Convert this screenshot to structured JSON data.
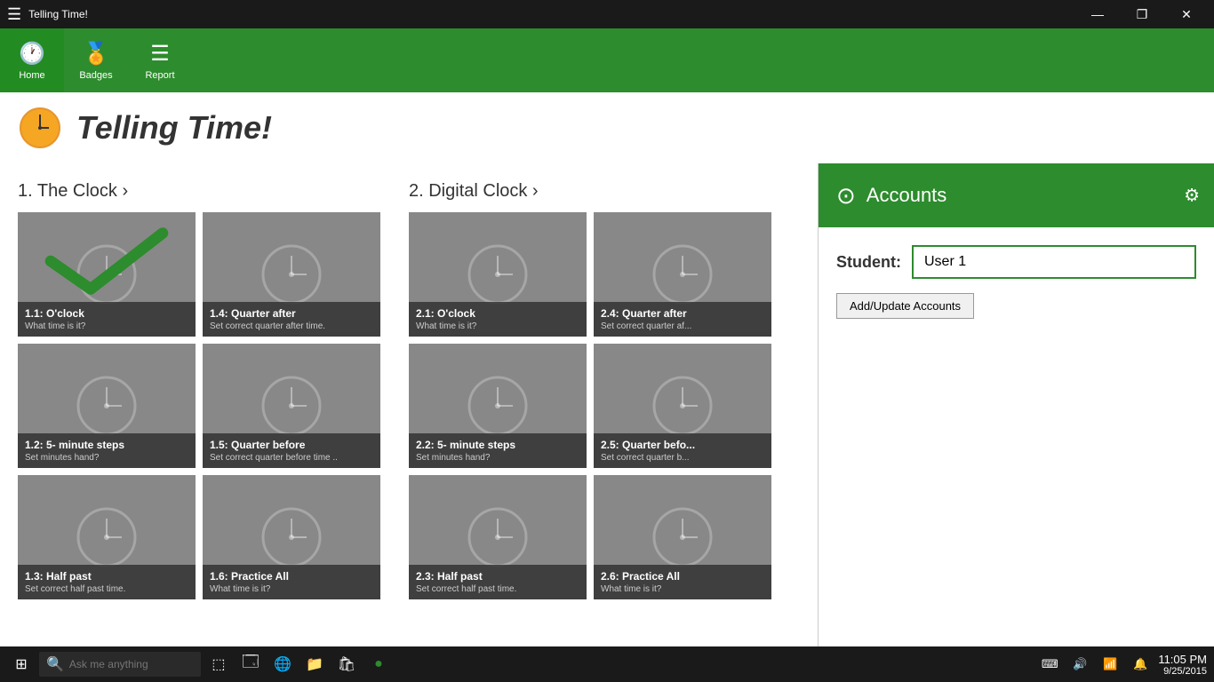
{
  "titleBar": {
    "appName": "Telling Time!",
    "minBtn": "—",
    "maxBtn": "❐",
    "closeBtn": "✕"
  },
  "toolbar": {
    "homeLabel": "Home",
    "badgesLabel": "Badges",
    "reportLabel": "Report"
  },
  "header": {
    "title": "Telling Time!"
  },
  "sections": [
    {
      "id": "clock",
      "title": "1. The Clock",
      "cards": [
        {
          "id": "1.1",
          "title": "1.1: O'clock",
          "subtitle": "What time is it?",
          "hasCheck": true
        },
        {
          "id": "1.4",
          "title": "1.4: Quarter after",
          "subtitle": "Set correct quarter after time.",
          "hasCheck": false
        },
        {
          "id": "1.2",
          "title": "1.2: 5- minute steps",
          "subtitle": "Set minutes hand?",
          "hasCheck": false
        },
        {
          "id": "1.5",
          "title": "1.5: Quarter before",
          "subtitle": "Set correct quarter before time ..",
          "hasCheck": false
        },
        {
          "id": "1.3",
          "title": "1.3: Half past",
          "subtitle": "Set correct half past time.",
          "hasCheck": false
        },
        {
          "id": "1.6",
          "title": "1.6: Practice All",
          "subtitle": "What time is it?",
          "hasCheck": false
        }
      ]
    },
    {
      "id": "digital",
      "title": "2. Digital Clock",
      "cards": [
        {
          "id": "2.1",
          "title": "2.1: O'clock",
          "subtitle": "What time is it?",
          "hasCheck": false
        },
        {
          "id": "2.4",
          "title": "2.4: Quarter after",
          "subtitle": "Set correct quarter af...",
          "hasCheck": false
        },
        {
          "id": "2.2",
          "title": "2.2: 5- minute steps",
          "subtitle": "Set minutes hand?",
          "hasCheck": false
        },
        {
          "id": "2.5",
          "title": "2.5: Quarter befo...",
          "subtitle": "Set correct quarter b...",
          "hasCheck": false
        },
        {
          "id": "2.3",
          "title": "2.3: Half past",
          "subtitle": "Set correct half past time.",
          "hasCheck": false
        },
        {
          "id": "2.6",
          "title": "2.6: Practice All",
          "subtitle": "What time is it?",
          "hasCheck": false
        }
      ]
    }
  ],
  "accounts": {
    "title": "Accounts",
    "studentLabel": "Student:",
    "studentValue": "User 1",
    "addUpdateLabel": "Add/Update Accounts"
  },
  "taskbar": {
    "searchPlaceholder": "Ask me anything",
    "time": "11:05 PM",
    "date": "9/25/2015"
  }
}
